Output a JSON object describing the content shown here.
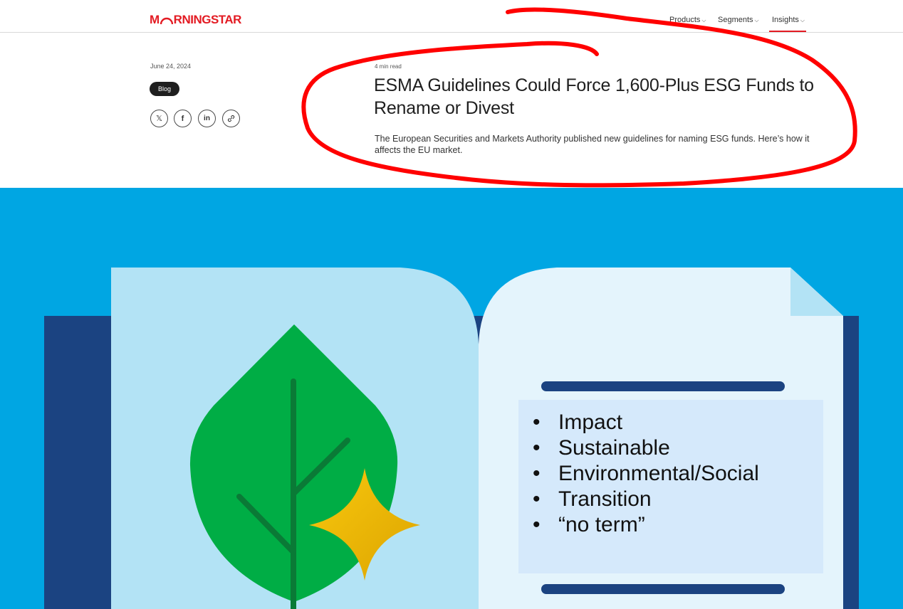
{
  "header": {
    "logo_text": "MORNINGSTAR",
    "nav": [
      {
        "label": "Products",
        "active": false
      },
      {
        "label": "Segments",
        "active": false
      },
      {
        "label": "Insights",
        "active": true
      }
    ],
    "chevron": "⌵"
  },
  "article": {
    "date": "June 24, 2024",
    "tag": "Blog",
    "read_time": "4 min read",
    "title": "ESMA Guidelines Could Force 1,600-Plus ESG Funds to Rename or Divest",
    "subtitle": "The European Securities and Markets Authority published new guidelines for naming ESG funds. Here’s how it affects the EU market."
  },
  "share_icons": [
    "x-icon",
    "facebook-icon",
    "linkedin-icon",
    "link-icon"
  ],
  "share_glyphs": {
    "x": "𝕏",
    "facebook": "f",
    "linkedin": "in",
    "link": "🔗"
  },
  "hero": {
    "bullets": [
      "Impact",
      "Sustainable",
      "Environmental/Social",
      "Transition",
      "“no term”"
    ]
  },
  "colors": {
    "brand_red": "#e31b23",
    "hero_blue": "#00a6e3",
    "navy": "#1b4381",
    "page_light": "#b3e3f5",
    "page_lighter": "#e4f4fc",
    "leaf_green": "#00ad45",
    "star_gold": "#f2b705",
    "annotation_red": "#ff0000"
  }
}
